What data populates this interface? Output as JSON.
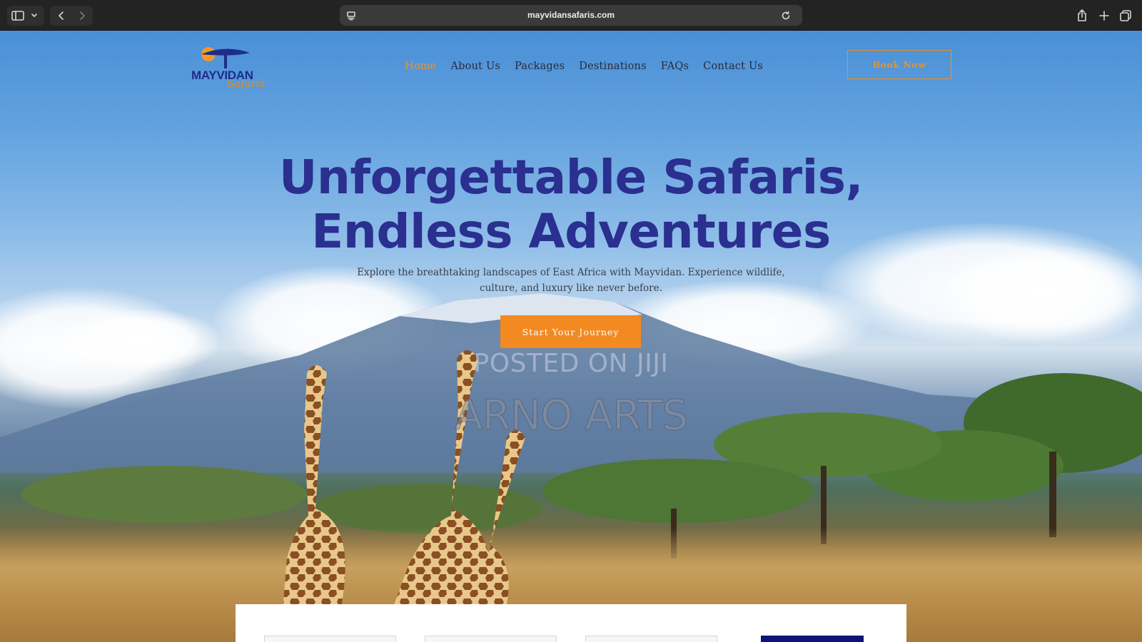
{
  "browser": {
    "url": "mayvidansafaris.com",
    "icons": [
      "sidebar-icon",
      "chevron-down-icon",
      "back-icon",
      "forward-icon",
      "reader-icon",
      "reload-icon",
      "share-icon",
      "new-tab-icon",
      "tabs-overview-icon"
    ]
  },
  "logo": {
    "brand": "MAYVIDAN",
    "sub": "Safaris"
  },
  "nav": {
    "items": [
      {
        "label": "Home",
        "active": true
      },
      {
        "label": "About Us"
      },
      {
        "label": "Packages"
      },
      {
        "label": "Destinations"
      },
      {
        "label": "FAQs"
      },
      {
        "label": "Contact Us"
      }
    ]
  },
  "header": {
    "book_label": "Book Now"
  },
  "hero": {
    "title_line1": "Unforgettable Safaris,",
    "title_line2": "Endless Adventures",
    "subtitle": "Explore the breathtaking landscapes of East Africa with Mayvidan. Experience wildlife, culture, and luxury like never before.",
    "cta_label": "Start Your Journey"
  },
  "watermarks": {
    "line1": "POSTED ON JIJI",
    "line2": "ARNO ARTS"
  },
  "colors": {
    "brand_blue": "#2a2f90",
    "accent_orange": "#f28a21",
    "card_dark": "#0d1479"
  }
}
